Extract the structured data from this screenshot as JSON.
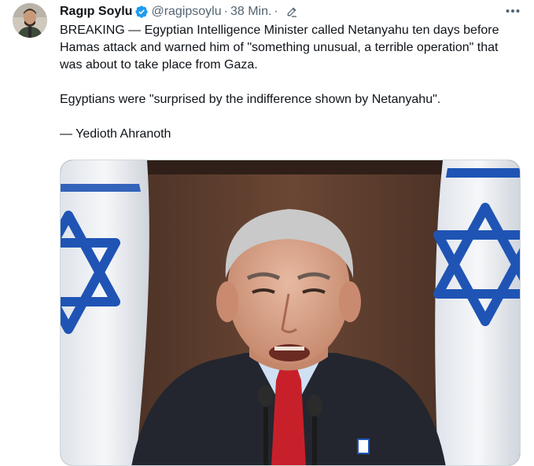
{
  "author": {
    "name": "Ragıp Soylu",
    "handle": "@ragipsoylu",
    "separator": "·",
    "time": "38 Min.",
    "time_separator": "·",
    "verified_color": "#1d9bf0"
  },
  "tweet": {
    "paragraphs": [
      "BREAKING — Egyptian Intelligence Minister called Netanyahu ten days before Hamas attack and warned him of \"something unusual, a terrible operation\" that was about to take place from Gaza.",
      "Egyptians were \"surprised by the indifference shown by Netanyahu\".",
      "— Yedioth Ahranoth"
    ]
  },
  "icons": {
    "verified": "verified-badge-icon",
    "edit": "edited-pencil-icon",
    "more": "more-options-icon"
  },
  "colors": {
    "flag_blue": "#1f54b5",
    "tie_red": "#c8202a",
    "background_wall": "#5a3b2c"
  }
}
